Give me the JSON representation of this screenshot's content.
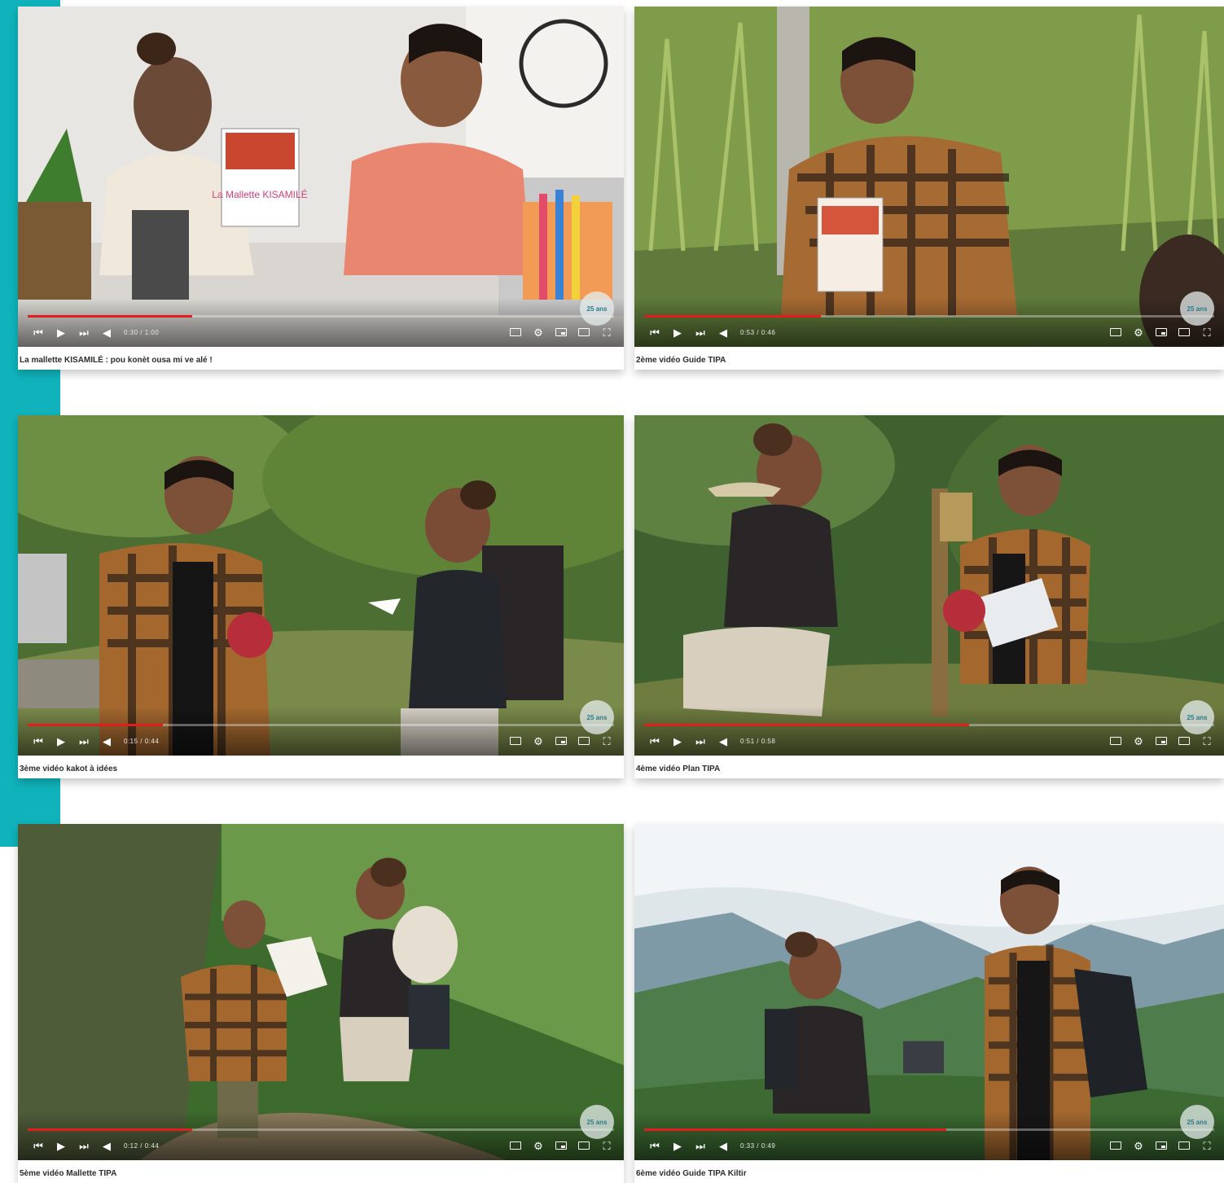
{
  "colors": {
    "accent": "#10b3bb",
    "progress": "#e11d1d"
  },
  "videos": [
    {
      "title": "La mallette KISAMILÉ : pou konèt ousa mi ve alé !",
      "time": "0:30 / 1:00",
      "progress": 0.28,
      "book_text": "La Mallette KISAMILÉ"
    },
    {
      "title": "2ème vidéo Guide TIPA",
      "time": "0:53 / 0:46",
      "progress": 0.31
    },
    {
      "title": "3ème vidéo kakot à idées",
      "time": "0:15 / 0:44",
      "progress": 0.23
    },
    {
      "title": "4ème vidéo Plan TIPA",
      "time": "0:51 / 0:58",
      "progress": 0.57
    },
    {
      "title": "5ème vidéo Mallette TIPA",
      "time": "0:12 / 0:44",
      "progress": 0.28
    },
    {
      "title": "6ème vidéo Guide TIPA Kiltir",
      "time": "0:33 / 0:49",
      "progress": 0.53
    }
  ],
  "watermark_text": "25 ans",
  "icons": {
    "prev": "skip-previous-icon",
    "play": "play-icon",
    "next": "skip-next-icon",
    "volume": "volume-icon",
    "subtitles": "subtitles-icon",
    "settings": "gear-icon",
    "miniplayer": "miniplayer-icon",
    "theater": "theater-icon",
    "fullscreen": "fullscreen-icon"
  }
}
